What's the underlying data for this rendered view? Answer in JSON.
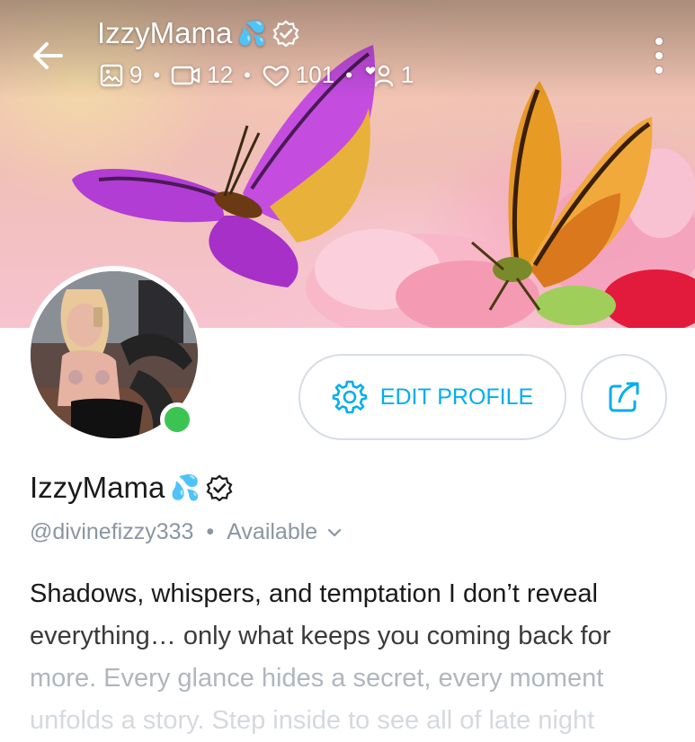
{
  "header": {
    "title": "IzzyMama",
    "title_emoji": "💦",
    "stats": {
      "photos": "9",
      "videos": "12",
      "likes": "101",
      "fans": "1"
    }
  },
  "profile": {
    "display_name": "IzzyMama",
    "name_emoji": "💦",
    "handle": "@divinefizzy333",
    "status": "Available",
    "online": true
  },
  "actions": {
    "edit_label": "EDIT PROFILE"
  },
  "bio": {
    "lines": [
      "Shadows, whispers, and temptation I don’t reveal",
      "everything… only what keeps you coming back for",
      "more. Every glance hides a secret, every moment",
      "unfolds a story. Step inside to see all of late night"
    ]
  },
  "colors": {
    "accent": "#00aeef",
    "muted": "#8a96a3",
    "online": "#3cc453",
    "border": "#d7dde5"
  }
}
